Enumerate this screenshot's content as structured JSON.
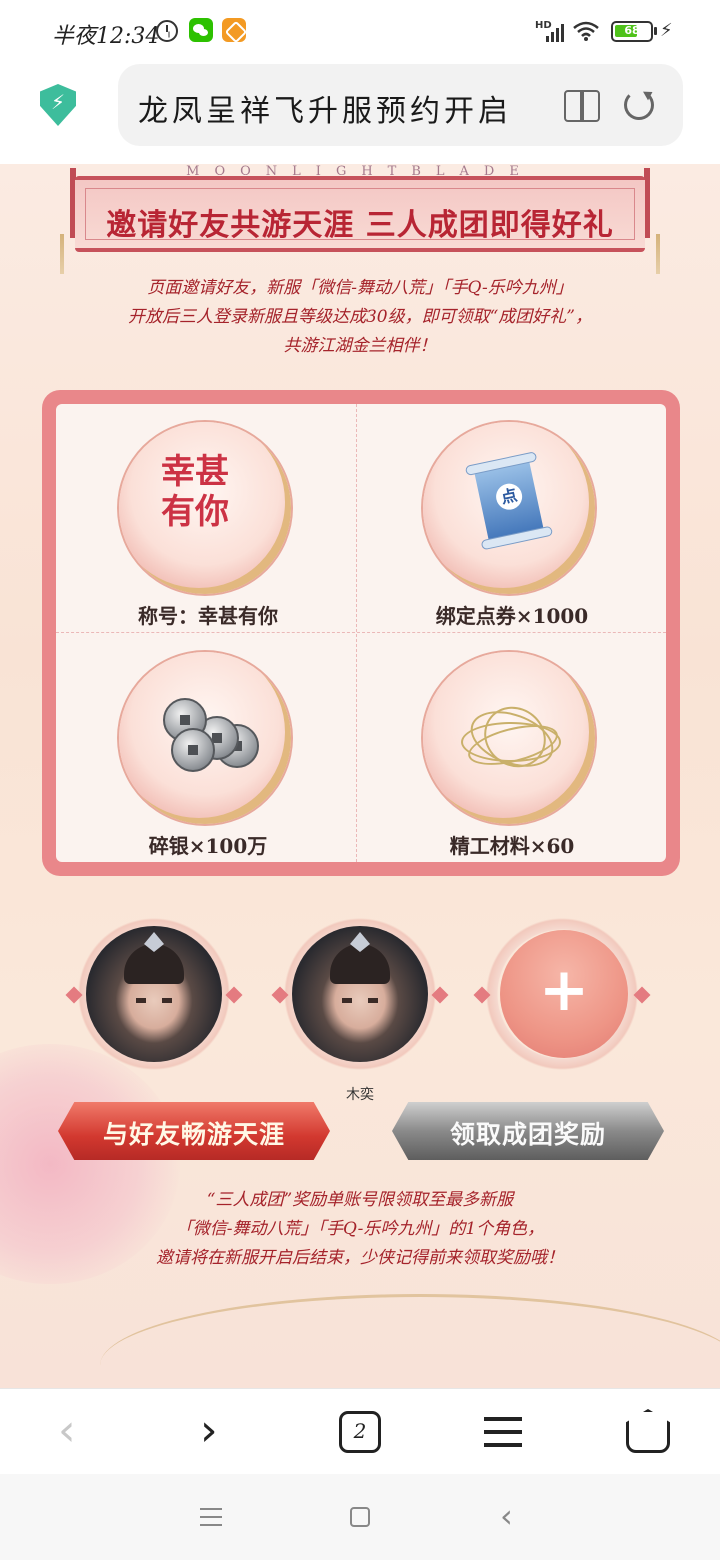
{
  "status_bar": {
    "time": "半夜12:34",
    "network": "HD",
    "battery": "68",
    "battery_level": 0.68
  },
  "browser": {
    "url_title": "龙凤呈祥飞升服预约开启",
    "tab_count": "2"
  },
  "page": {
    "brand": "MOONLIGHTBLADE",
    "banner_title": "邀请好友共游天涯 三人成团即得好礼",
    "intro_lines": [
      "页面邀请好友，新服「微信-舞动八荒」「手Q-乐吟九州」",
      "开放后三人登录新服且等级达成30级，即可领取“成团好礼”，",
      "共游江湖金兰相伴！"
    ],
    "rewards": [
      {
        "label": "称号：幸甚有你",
        "icon": "title-seal-icon",
        "seal_lines": [
          "幸甚",
          "有你"
        ]
      },
      {
        "label": "绑定点券×1000",
        "icon": "coupon-scroll-icon",
        "scroll_char": "点"
      },
      {
        "label": "碎银×100万",
        "icon": "silver-coins-icon"
      },
      {
        "label": "精工材料×60",
        "icon": "material-rope-icon"
      }
    ],
    "team": {
      "member_name": "木奕"
    },
    "buttons": {
      "invite": "与好友畅游天涯",
      "claim": "领取成团奖励"
    },
    "outro_lines": [
      "“三人成团”奖励单账号限领取至最多新服",
      "「微信-舞动八荒」「手Q-乐吟九州」的1个角色，",
      "邀请将在新服开启后结束，少侠记得前来领取奖励哦！"
    ]
  },
  "colors": {
    "accent_red": "#b82534",
    "panel_pink": "#e9878a",
    "page_bg": "#fbebe2"
  }
}
